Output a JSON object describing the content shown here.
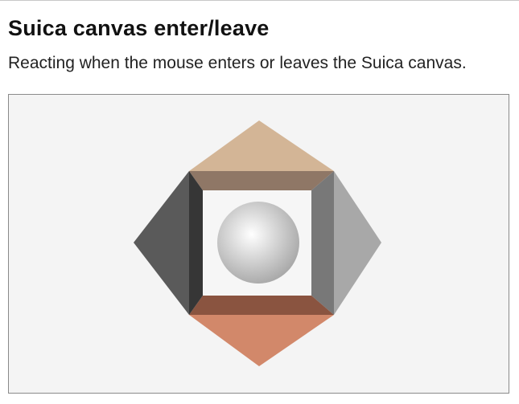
{
  "page": {
    "title": "Suica canvas enter/leave",
    "subtitle": "Reacting when the mouse enters or leaves the Suica canvas."
  },
  "canvas": {
    "background": "#f4f4f4",
    "border": "#8a8a8a",
    "scene": "pyramid-frame-with-sphere",
    "colors": {
      "top_outer": "#d3b596",
      "top_inner": "#8f7766",
      "right_outer": "#a8a8a8",
      "right_inner": "#787878",
      "bottom_outer": "#d2886a",
      "bottom_inner": "#8a5440",
      "left_outer": "#5a5a5a",
      "left_inner": "#363636",
      "hole": "#f6f6f6",
      "sphere_light": "#ffffff",
      "sphere_dark": "#a9a9a9"
    }
  }
}
